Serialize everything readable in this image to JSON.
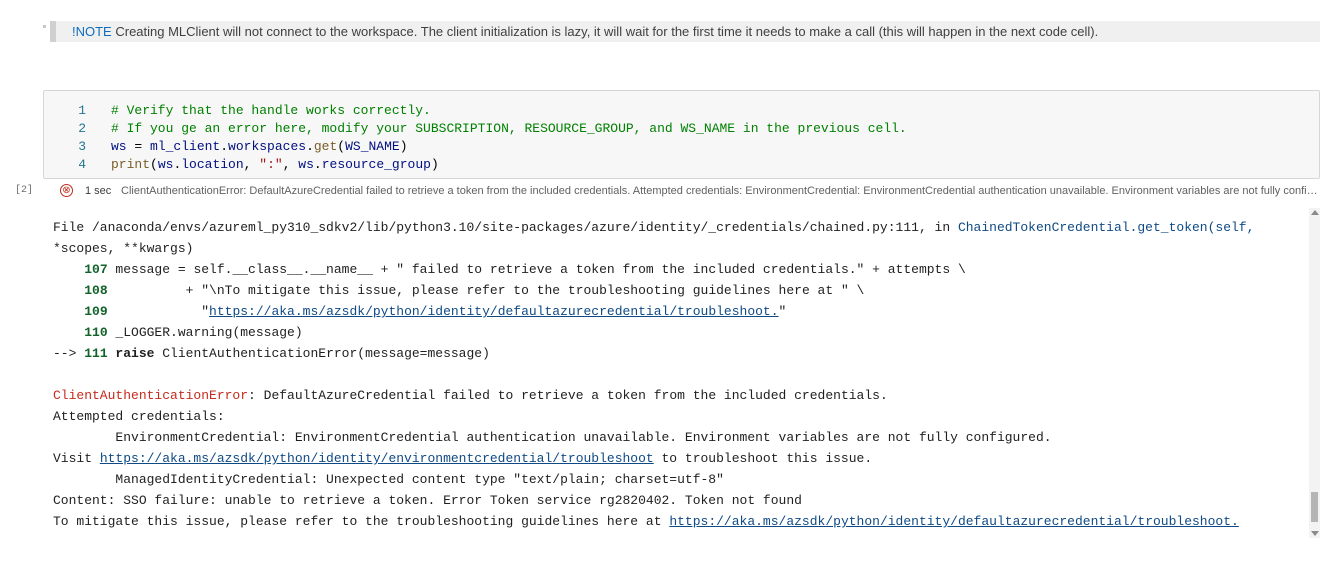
{
  "markdown_cell": {
    "note_label": "!NOTE",
    "text": " Creating MLClient will not connect to the workspace. The client initialization is lazy, it will wait for the first time it needs to make a call (this will happen in the next code cell)."
  },
  "code_cell": {
    "lines": [
      {
        "num": "1",
        "comment": "# Verify that the handle works correctly."
      },
      {
        "num": "2",
        "comment": "# If you ge an error here, modify your SUBSCRIPTION, RESOURCE_GROUP, and WS_NAME in the previous cell."
      },
      {
        "num": "3",
        "v1": "ws",
        "op1": " = ",
        "v2": "ml_client",
        "op2": ".",
        "v3": "workspaces",
        "op3": ".",
        "fn": "get",
        "op4": "(",
        "v4": "WS_NAME",
        "op5": ")"
      },
      {
        "num": "4",
        "fn": "print",
        "op1": "(",
        "v1": "ws",
        "op2": ".",
        "v2": "location",
        "op3": ", ",
        "str": "\":\"",
        "op4": ", ",
        "v3": "ws",
        "op5": ".",
        "v4": "resource_group",
        "op6": ")"
      }
    ]
  },
  "status": {
    "exec_count": "[2]",
    "icon": "⊗",
    "time": "1 sec",
    "message": "ClientAuthenticationError: DefaultAzureCredential failed to retrieve a token from the included credentials. Attempted credentials: EnvironmentCredential: EnvironmentCredential authentication unavailable. Environment variables are not fully configured."
  },
  "output": {
    "file_prefix": "File /anaconda/envs/azureml_py310_sdkv2/lib/python3.10/site-packages/azure/identity/_credentials/chained.py:111, in ",
    "file_func": "ChainedTokenCredential.get_token(self,",
    "file_args": "*scopes, **kwargs)",
    "l107_num": "107",
    "l107": " message = self.__class__.__name__ + \" failed to retrieve a token from the included credentials.\" + attempts \\",
    "l108_num": "108",
    "l108": "          + \"\\nTo mitigate this issue, please refer to the troubleshooting guidelines here at \" \\",
    "l109_num": "109",
    "l109_pre": "            \"",
    "l109_link": "https://aka.ms/azsdk/python/identity/defaultazurecredential/troubleshoot.",
    "l109_post": "\"",
    "l110_num": "110",
    "l110": " _LOGGER.warning(message)",
    "l111_arrow": "--> ",
    "l111_num": "111",
    "l111_kw": " raise",
    "l111": " ClientAuthenticationError(message=message)",
    "err_name": "ClientAuthenticationError",
    "err_msg": ": DefaultAzureCredential failed to retrieve a token from the included credentials.",
    "attempted": "Attempted credentials:",
    "env_cred": "        EnvironmentCredential: EnvironmentCredential authentication unavailable. Environment variables are not fully configured.",
    "visit_pre": "Visit ",
    "visit_link": "https://aka.ms/azsdk/python/identity/environmentcredential/troubleshoot",
    "visit_post": " to troubleshoot this issue.",
    "managed": "        ManagedIdentityCredential: Unexpected content type \"text/plain; charset=utf-8\"",
    "content": "Content: SSO failure: unable to retrieve a token. Error Token service rg2820402. Token not found",
    "mitigate_pre": "To mitigate this issue, please refer to the troubleshooting guidelines here at ",
    "mitigate_link": "https://aka.ms/azsdk/python/identity/defaultazurecredential/troubleshoot."
  }
}
